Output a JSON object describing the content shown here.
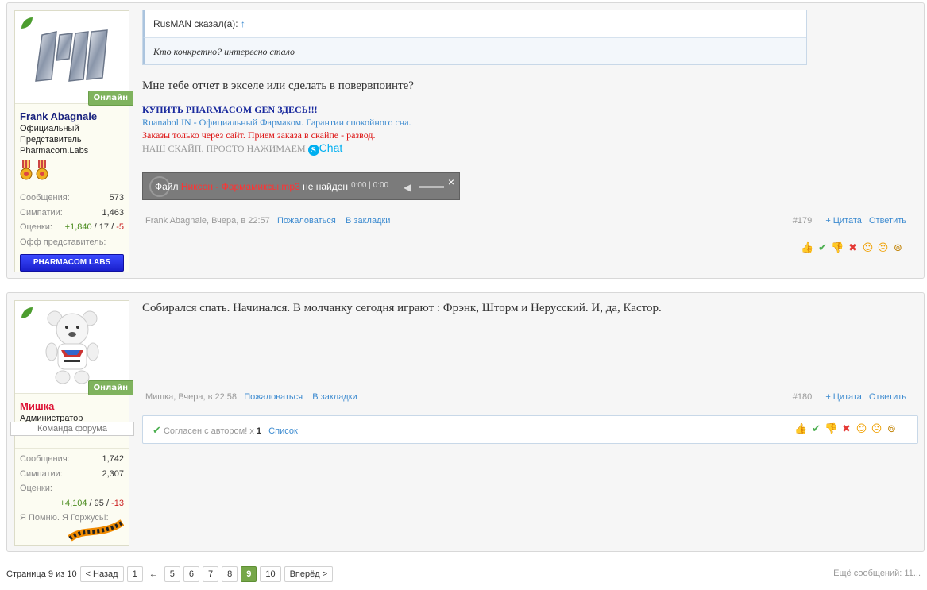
{
  "posts": [
    {
      "user": {
        "name": "Frank Abagnale",
        "name_color": "#1a237e",
        "online": "Онлайн",
        "title_lines": [
          "Официальный",
          "Представитель",
          "Pharmacom.Labs"
        ],
        "stats": {
          "messages_label": "Сообщения:",
          "messages": "573",
          "likes_label": "Симпатии:",
          "likes": "1,463",
          "ratings_label": "Оценки:",
          "ratings_pos": "+1,840",
          "ratings_mid": "17",
          "ratings_neg": "-5",
          "extra_label": "Офф представитель:",
          "badge": "PHARMACOM LABS"
        }
      },
      "quote": {
        "author": "RusMAN сказал(а):",
        "arrow": "↑",
        "text": "Кто конкретно? интересно стало"
      },
      "text": "Мне тебе отчет в экселе или сделать в повервпоинте?",
      "signature": {
        "line1": "КУПИТЬ PHARMACOM GEN ЗДЕСЬ!!!",
        "line2": "Ruanabol.IN - Официальный Фармаком. Гарантии спокойного сна.",
        "line3": "Заказы только через сайт. Прием заказа в скайпе - развод.",
        "line4": "НАШ СКАЙП. ПРОСТО НАЖИМАЕМ",
        "skype": "Chat"
      },
      "player": {
        "prefix": "Файл",
        "file": "Никсон - Фармамиксы.mp3",
        "suffix": "не найден",
        "time1": "0:00",
        "time2": "0:00",
        "close": "×"
      },
      "meta": {
        "author_time": "Frank Abagnale, Вчера, в 22:57",
        "report": "Пожаловаться",
        "bookmark": "В закладки"
      },
      "meta_right": {
        "num": "#179",
        "quote": "+ Цитата",
        "reply": "Ответить"
      }
    },
    {
      "user": {
        "name": "Мишка",
        "name_color": "#dd1133",
        "online": "Онлайн",
        "title_lines": [
          "Администратор"
        ],
        "team": "Команда форума",
        "stats": {
          "messages_label": "Сообщения:",
          "messages": "1,742",
          "likes_label": "Симпатии:",
          "likes": "2,307",
          "ratings_label": "Оценки:",
          "ratings_pos": "+4,104",
          "ratings_mid": "95",
          "ratings_neg": "-13",
          "extra_label": "Я Помню. Я Горжусь!:"
        }
      },
      "text": "Собирался спать. Начинался. В молчанку сегодня играют : Фрэнк, Шторм и Нерусский. И, да, Кастор.",
      "meta": {
        "author_time": "Мишка, Вчера, в 22:58",
        "report": "Пожаловаться",
        "bookmark": "В закладки"
      },
      "meta_right": {
        "num": "#180",
        "quote": "+ Цитата",
        "reply": "Ответить"
      },
      "likes_bar": {
        "text": "Согласен с автором!",
        "times": "x",
        "count": "1",
        "list": "Список"
      }
    }
  ],
  "pager": {
    "label": "Страница 9 из 10",
    "prev": "< Назад",
    "first": "1",
    "ellipsis": "←",
    "pages": [
      "5",
      "6",
      "7",
      "8",
      "9",
      "10"
    ],
    "current": "9",
    "next": "Вперёд >",
    "more": "Ещё сообщений: 11..."
  },
  "colors": {
    "accent": "#3d8bd0",
    "online": "#7fb35e",
    "current_page": "#76a749"
  }
}
